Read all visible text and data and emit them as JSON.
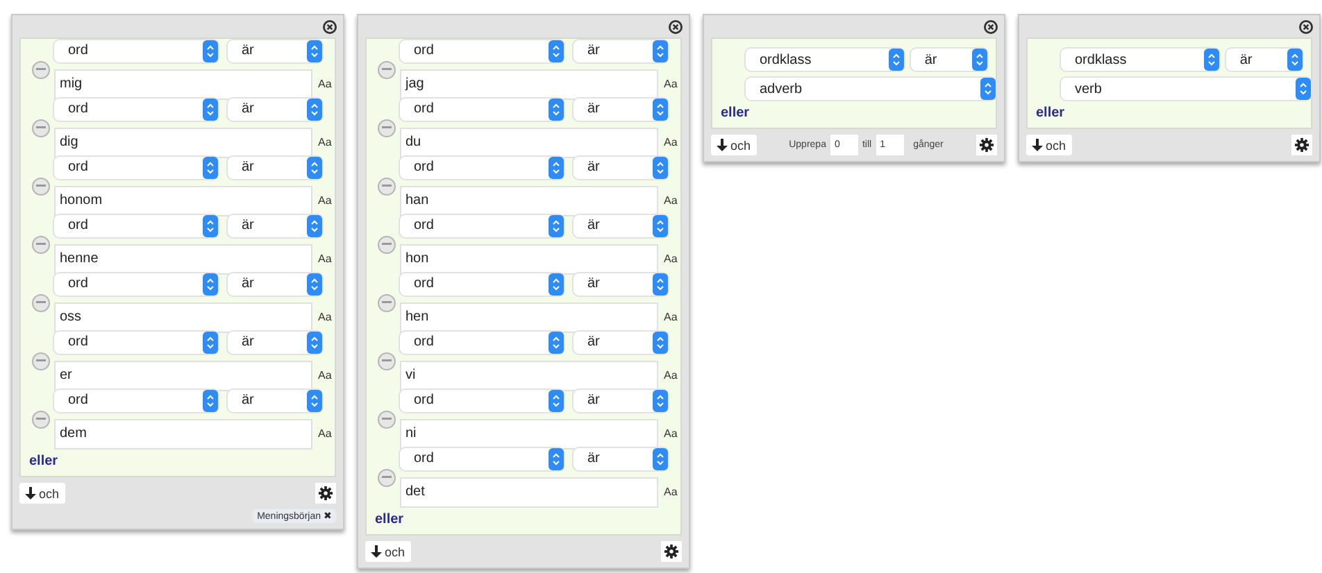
{
  "tokens": [
    {
      "rows": [
        {
          "kind": "word",
          "attribute": "ord",
          "operator": "är",
          "value": "mig",
          "case_label": "Aa"
        },
        {
          "kind": "word",
          "attribute": "ord",
          "operator": "är",
          "value": "dig",
          "case_label": "Aa"
        },
        {
          "kind": "word",
          "attribute": "ord",
          "operator": "är",
          "value": "honom",
          "case_label": "Aa"
        },
        {
          "kind": "word",
          "attribute": "ord",
          "operator": "är",
          "value": "henne",
          "case_label": "Aa"
        },
        {
          "kind": "word",
          "attribute": "ord",
          "operator": "är",
          "value": "oss",
          "case_label": "Aa"
        },
        {
          "kind": "word",
          "attribute": "ord",
          "operator": "är",
          "value": "er",
          "case_label": "Aa"
        },
        {
          "kind": "word",
          "attribute": "ord",
          "operator": "är",
          "value": "dem",
          "case_label": "Aa"
        }
      ],
      "or_label": "eller",
      "and_label": "och",
      "tag": {
        "label": "Meningsbörjan",
        "remove": "✖"
      }
    },
    {
      "rows": [
        {
          "kind": "word",
          "attribute": "ord",
          "operator": "är",
          "value": "jag",
          "case_label": "Aa"
        },
        {
          "kind": "word",
          "attribute": "ord",
          "operator": "är",
          "value": "du",
          "case_label": "Aa"
        },
        {
          "kind": "word",
          "attribute": "ord",
          "operator": "är",
          "value": "han",
          "case_label": "Aa"
        },
        {
          "kind": "word",
          "attribute": "ord",
          "operator": "är",
          "value": "hon",
          "case_label": "Aa"
        },
        {
          "kind": "word",
          "attribute": "ord",
          "operator": "är",
          "value": "hen",
          "case_label": "Aa"
        },
        {
          "kind": "word",
          "attribute": "ord",
          "operator": "är",
          "value": "vi",
          "case_label": "Aa"
        },
        {
          "kind": "word",
          "attribute": "ord",
          "operator": "är",
          "value": "ni",
          "case_label": "Aa"
        },
        {
          "kind": "word",
          "attribute": "ord",
          "operator": "är",
          "value": "det",
          "case_label": "Aa"
        }
      ],
      "or_label": "eller",
      "and_label": "och"
    },
    {
      "rows": [
        {
          "kind": "class",
          "attribute": "ordklass",
          "operator": "är",
          "value": "adverb"
        }
      ],
      "or_label": "eller",
      "and_label": "och",
      "repeat": {
        "label": "Upprepa",
        "from": "0",
        "to_label": "till",
        "to": "1",
        "unit": "gånger"
      }
    },
    {
      "rows": [
        {
          "kind": "class",
          "attribute": "ordklass",
          "operator": "är",
          "value": "verb"
        }
      ],
      "or_label": "eller",
      "and_label": "och"
    }
  ]
}
